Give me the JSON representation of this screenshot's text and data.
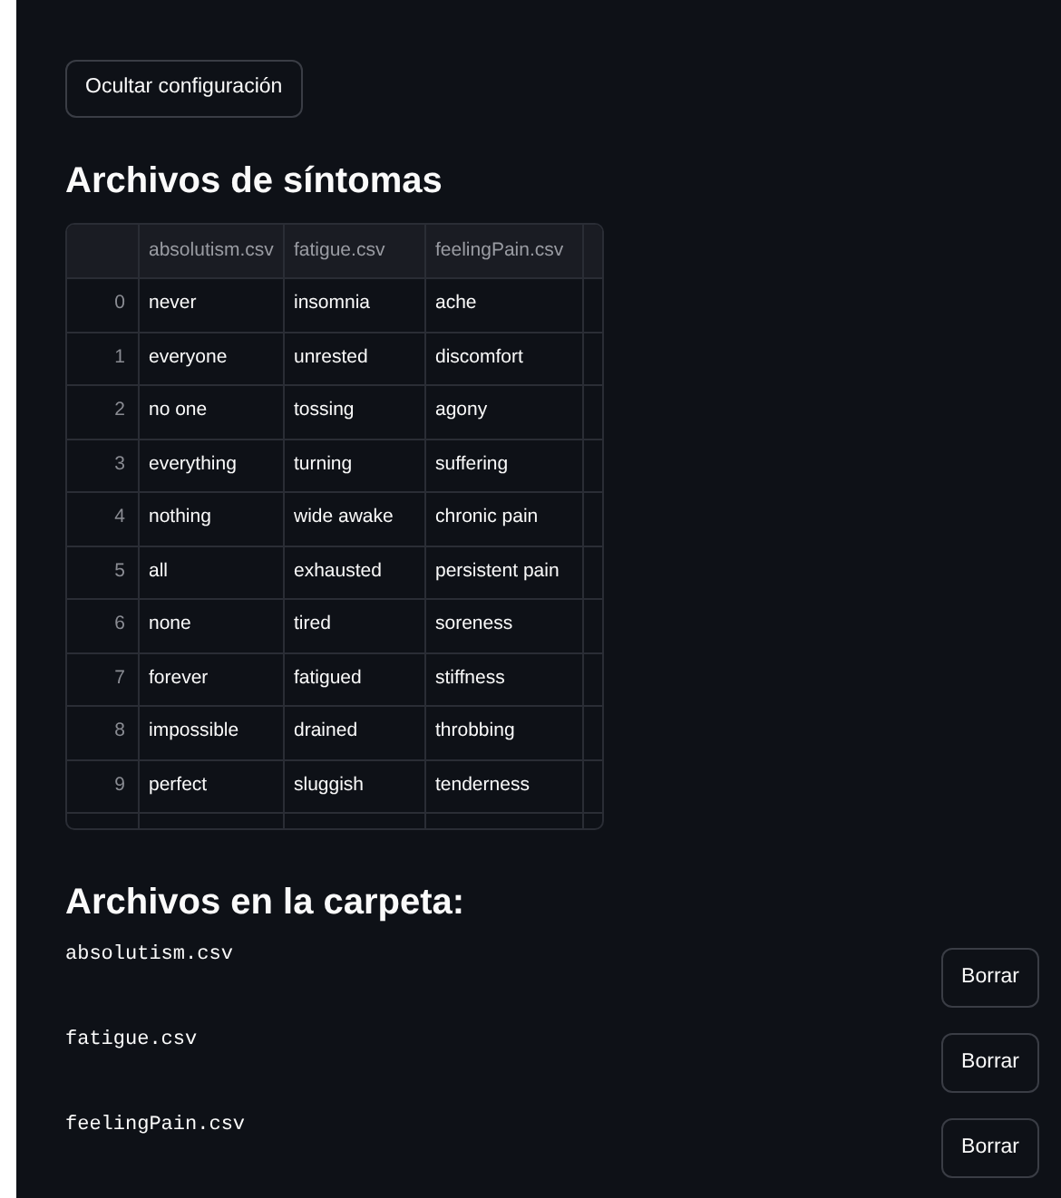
{
  "toggle_button": "Ocultar configuración",
  "symptoms_title": "Archivos de síntomas",
  "table": {
    "columns": [
      "absolutism.csv",
      "fatigue.csv",
      "feelingPain.csv"
    ],
    "rows": [
      {
        "index": "0",
        "cells": [
          "never",
          "insomnia",
          "ache"
        ]
      },
      {
        "index": "1",
        "cells": [
          "everyone",
          "unrested",
          "discomfort"
        ]
      },
      {
        "index": "2",
        "cells": [
          "no one",
          "tossing",
          "agony"
        ]
      },
      {
        "index": "3",
        "cells": [
          "everything",
          "turning",
          "suffering"
        ]
      },
      {
        "index": "4",
        "cells": [
          "nothing",
          "wide awake",
          "chronic pain"
        ]
      },
      {
        "index": "5",
        "cells": [
          "all",
          "exhausted",
          "persistent pain"
        ]
      },
      {
        "index": "6",
        "cells": [
          "none",
          "tired",
          "soreness"
        ]
      },
      {
        "index": "7",
        "cells": [
          "forever",
          "fatigued",
          "stiffness"
        ]
      },
      {
        "index": "8",
        "cells": [
          "impossible",
          "drained",
          "throbbing"
        ]
      },
      {
        "index": "9",
        "cells": [
          "perfect",
          "sluggish",
          "tenderness"
        ]
      }
    ]
  },
  "folder_title": "Archivos en la carpeta:",
  "files": [
    {
      "name": "absolutism.csv",
      "button": "Borrar"
    },
    {
      "name": "fatigue.csv",
      "button": "Borrar"
    },
    {
      "name": "feelingPain.csv",
      "button": "Borrar"
    }
  ]
}
